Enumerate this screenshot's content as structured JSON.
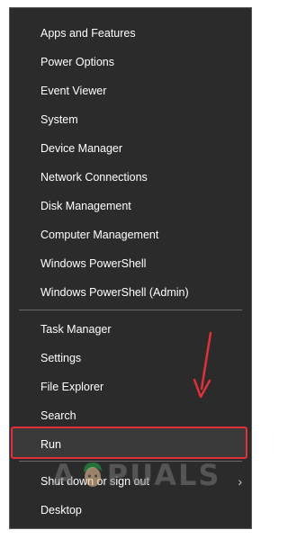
{
  "menu": {
    "group1": [
      {
        "label": "Apps and Features"
      },
      {
        "label": "Power Options"
      },
      {
        "label": "Event Viewer"
      },
      {
        "label": "System"
      },
      {
        "label": "Device Manager"
      },
      {
        "label": "Network Connections"
      },
      {
        "label": "Disk Management"
      },
      {
        "label": "Computer Management"
      },
      {
        "label": "Windows PowerShell"
      },
      {
        "label": "Windows PowerShell (Admin)"
      }
    ],
    "group2": [
      {
        "label": "Task Manager"
      },
      {
        "label": "Settings"
      },
      {
        "label": "File Explorer"
      },
      {
        "label": "Search"
      },
      {
        "label": "Run",
        "highlighted": true
      }
    ],
    "group3": [
      {
        "label": "Shut down or sign out",
        "submenu": true,
        "chevron": "›"
      },
      {
        "label": "Desktop"
      }
    ]
  },
  "annotation": {
    "arrow_color": "#e0313a",
    "highlight_color": "#e0313a"
  },
  "watermark": {
    "text_left": "A",
    "text_right": "PUALS"
  }
}
